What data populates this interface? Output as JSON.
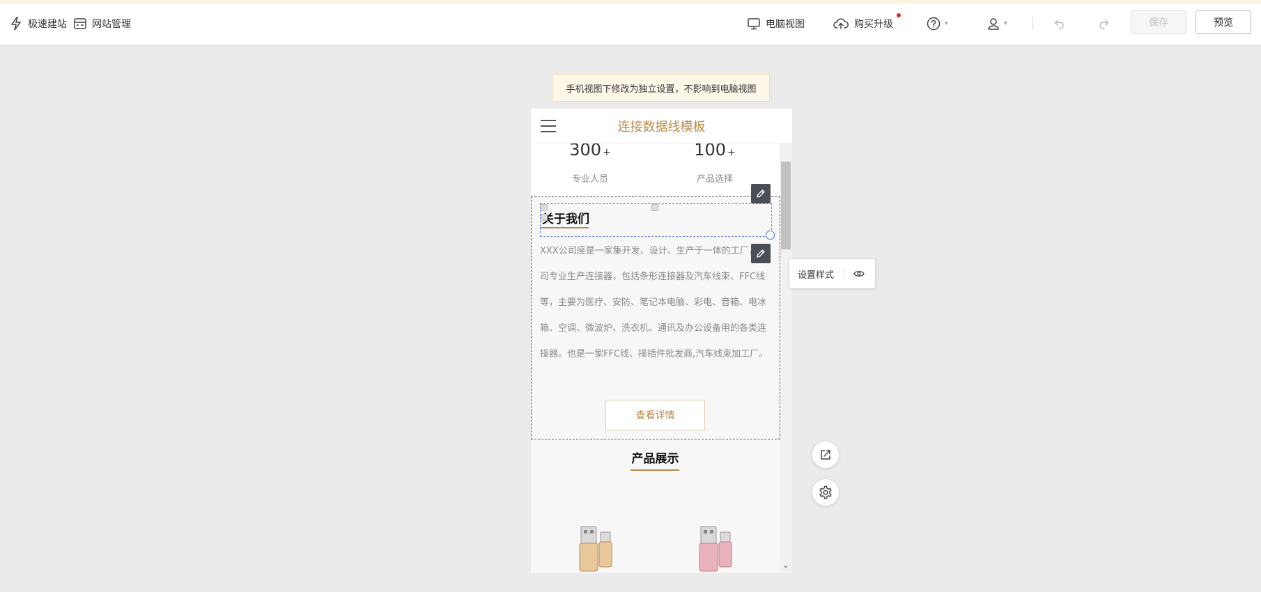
{
  "toolbar": {
    "quick_build": "极速建站",
    "site_manage": "网站管理",
    "desktop_view": "电脑视图",
    "buy_upgrade": "购买升级",
    "save": "保存",
    "preview": "预览"
  },
  "notice": "手机视图下修改为独立设置，不影响到电脑视图",
  "phone": {
    "site_title": "连接数据线模板",
    "stats": [
      {
        "num": "300",
        "suffix": "+",
        "caption": "专业人员"
      },
      {
        "num": "100",
        "suffix": "+",
        "caption": "产品选择"
      }
    ],
    "about": {
      "title": "关于我们",
      "text": "XXX公司座是一家集开发、设计、生产于一体的工厂，公司专业生产连接器，包括条形连接器及汽车线束、FFC线等，主要为医疗、安防、笔记本电脑、彩电、音箱、电冰箱、空调、微波炉、洗衣机、通讯及办公设备用的各类连接器。也是一家FFC线、接插件批发商,汽车线束加工厂。",
      "button": "查看详情"
    },
    "products": {
      "title": "产品展示"
    }
  },
  "style_popover": {
    "label": "设置样式"
  },
  "colors": {
    "accent": "#b88a4c",
    "save_disabled": "#c4c4c4",
    "notice_bg": "#fdf7e8"
  }
}
